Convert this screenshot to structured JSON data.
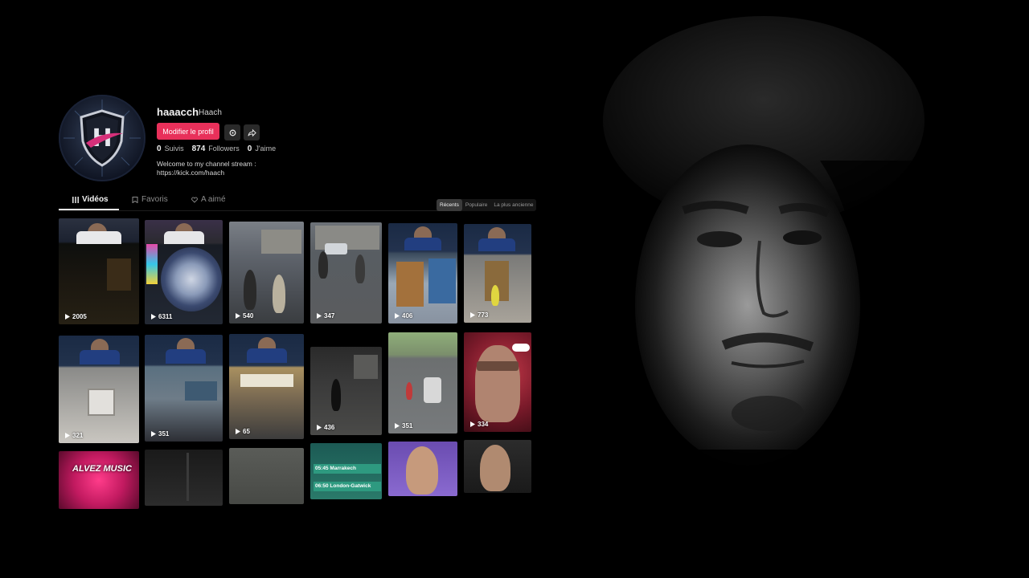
{
  "profile": {
    "username": "haaacch",
    "display_name": "Haach",
    "edit_button": "Modifier le profil",
    "stats": [
      {
        "value": "0",
        "label": "Suivis"
      },
      {
        "value": "874",
        "label": "Followers"
      },
      {
        "value": "0",
        "label": "J'aime"
      }
    ],
    "bio_line1": "Welcome to my channel stream :",
    "bio_line2": "https://kick.com/haach"
  },
  "tabs": [
    {
      "label": "Vidéos",
      "icon": "grid-icon",
      "active": true
    },
    {
      "label": "Favoris",
      "icon": "bookmark-icon",
      "active": false
    },
    {
      "label": "A aimé",
      "icon": "heart-icon",
      "active": false
    }
  ],
  "sort": {
    "options": [
      "Récents",
      "Populaire",
      "La plus ancienne"
    ],
    "selected": "Récents"
  },
  "videos": [
    {
      "views": "2005"
    },
    {
      "views": "6311"
    },
    {
      "views": "540"
    },
    {
      "views": "347"
    },
    {
      "views": "406"
    },
    {
      "views": "773"
    },
    {
      "views": "321"
    },
    {
      "views": "351"
    },
    {
      "views": "65"
    },
    {
      "views": "436"
    },
    {
      "views": "351"
    },
    {
      "views": "334"
    },
    {
      "title": "ALVEZ MUSIC"
    },
    {},
    {},
    {
      "lines": [
        "05:45 Marrakech",
        "06:50 London-Gatwick"
      ]
    },
    {},
    {}
  ],
  "colors": {
    "accent": "#e8305a",
    "background": "#000000",
    "tile_dark": "#1b1b1b"
  }
}
